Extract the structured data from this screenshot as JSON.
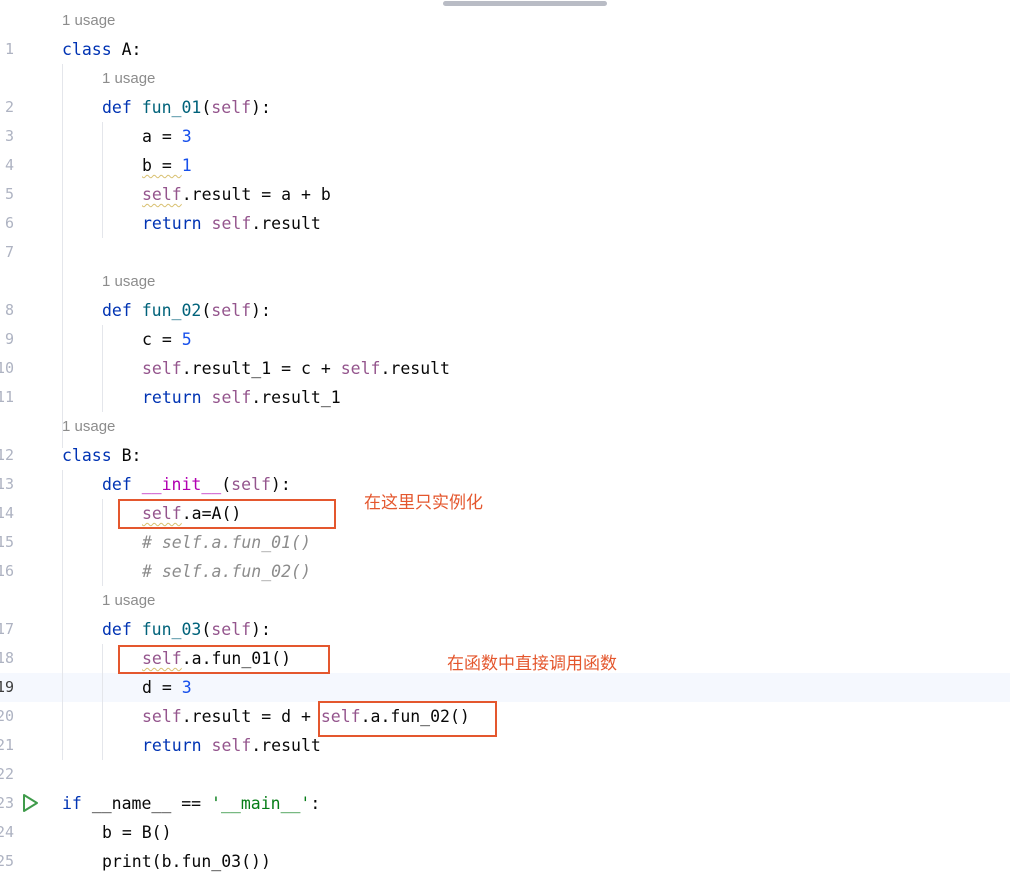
{
  "editor": {
    "lines": [
      {
        "n": "1",
        "hint": "1 usage",
        "tokens": [
          [
            "kw",
            "class"
          ],
          [
            "",
            "A:"
          ]
        ]
      },
      {
        "n": "2",
        "hint": "1 usage",
        "tokens": [
          [
            "kw",
            "def"
          ],
          [
            "fn",
            "fun_01"
          ],
          [
            "",
            "("
          ],
          [
            "self",
            "self"
          ],
          [
            "",
            "):"
          ]
        ]
      },
      {
        "n": "3",
        "tokens": [
          [
            "",
            "a = "
          ],
          [
            "num",
            "3"
          ]
        ]
      },
      {
        "n": "4",
        "tokens": [
          [
            "",
            "b = "
          ],
          [
            "num",
            "1"
          ]
        ]
      },
      {
        "n": "5",
        "tokens": [
          [
            "self",
            "self"
          ],
          [
            "",
            ".result = a + b"
          ]
        ]
      },
      {
        "n": "6",
        "tokens": [
          [
            "kw",
            "return"
          ],
          [
            "self",
            "self"
          ],
          [
            "",
            ".result"
          ]
        ]
      },
      {
        "n": "7",
        "tokens": []
      },
      {
        "n": "8",
        "hint": "1 usage",
        "tokens": [
          [
            "kw",
            "def"
          ],
          [
            "fn",
            "fun_02"
          ],
          [
            "",
            "("
          ],
          [
            "self",
            "self"
          ],
          [
            "",
            "):"
          ]
        ]
      },
      {
        "n": "9",
        "tokens": [
          [
            "",
            "c = "
          ],
          [
            "num",
            "5"
          ]
        ]
      },
      {
        "n": "10",
        "tokens": [
          [
            "self",
            "self"
          ],
          [
            "",
            ".result_1 = c + "
          ],
          [
            "self",
            "self"
          ],
          [
            "",
            ".result"
          ]
        ]
      },
      {
        "n": "11",
        "tokens": [
          [
            "kw",
            "return"
          ],
          [
            "self",
            "self"
          ],
          [
            "",
            ".result_1"
          ]
        ]
      },
      {
        "n": "12",
        "hint": "1 usage",
        "tokens": [
          [
            "kw",
            "class"
          ],
          [
            "",
            "B:"
          ]
        ]
      },
      {
        "n": "13",
        "tokens": [
          [
            "kw",
            "def"
          ],
          [
            "dunder",
            "__init__"
          ],
          [
            "",
            "("
          ],
          [
            "self",
            "self"
          ],
          [
            "",
            "):"
          ]
        ]
      },
      {
        "n": "14",
        "tokens": [
          [
            "self",
            "self"
          ],
          [
            "",
            ".a=A()"
          ]
        ]
      },
      {
        "n": "15",
        "tokens": [
          [
            "cmt",
            "# self.a.fun_01()"
          ]
        ]
      },
      {
        "n": "16",
        "tokens": [
          [
            "cmt",
            "# self.a.fun_02()"
          ]
        ]
      },
      {
        "n": "17",
        "hint": "1 usage",
        "tokens": [
          [
            "kw",
            "def"
          ],
          [
            "fn",
            "fun_03"
          ],
          [
            "",
            "("
          ],
          [
            "self",
            "self"
          ],
          [
            "",
            "):"
          ]
        ]
      },
      {
        "n": "18",
        "tokens": [
          [
            "self",
            "self"
          ],
          [
            "",
            ".a.fun_01()"
          ]
        ]
      },
      {
        "n": "19",
        "tokens": [
          [
            "",
            "d = "
          ],
          [
            "num",
            "3"
          ]
        ]
      },
      {
        "n": "20",
        "tokens": [
          [
            "self",
            "self"
          ],
          [
            "",
            ".result = d + "
          ],
          [
            "self",
            "self"
          ],
          [
            "",
            ".a.fun_02()"
          ]
        ]
      },
      {
        "n": "21",
        "tokens": [
          [
            "kw",
            "return"
          ],
          [
            "self",
            "self"
          ],
          [
            "",
            ".result"
          ]
        ]
      },
      {
        "n": "22",
        "tokens": []
      },
      {
        "n": "23",
        "tokens": [
          [
            "kw",
            "if"
          ],
          [
            "",
            "__name__ == "
          ],
          [
            "str",
            "'__main__'"
          ],
          [
            "",
            ":"
          ]
        ]
      },
      {
        "n": "24",
        "tokens": [
          [
            "",
            "b = B()"
          ]
        ]
      },
      {
        "n": "25",
        "tokens": [
          [
            "",
            "print(b.fun_03())"
          ]
        ]
      }
    ],
    "current_line": "19",
    "run_line": "23"
  },
  "annotations": [
    {
      "id": "note-instantiate",
      "text": "在这里只实例化"
    },
    {
      "id": "note-call",
      "text": "在函数中直接调用函数"
    }
  ],
  "colors": {
    "keyword": "#0033b3",
    "function": "#00627a",
    "self": "#94558d",
    "number": "#1750eb",
    "string": "#067d17",
    "comment": "#8c8c8c",
    "annotation": "#e4572e",
    "current_line": "#f5f8fe"
  },
  "icons": {
    "run": "run-triangle-icon"
  }
}
